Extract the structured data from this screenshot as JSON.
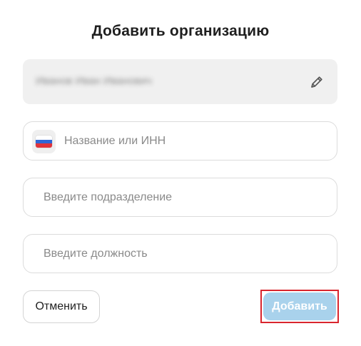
{
  "dialog": {
    "title": "Добавить организацию"
  },
  "user_field": {
    "value": "Иванов Иван Иванович",
    "edit_icon": "pencil-icon"
  },
  "organization": {
    "placeholder": "Название или ИНН",
    "country_flag": "russia-flag-icon"
  },
  "department": {
    "placeholder": "Введите подразделение"
  },
  "position": {
    "placeholder": "Введите должность"
  },
  "actions": {
    "cancel_label": "Отменить",
    "add_label": "Добавить"
  },
  "colors": {
    "add_button_bg": "#a9d2ec",
    "highlight_border": "#d9262e",
    "readonly_bg": "#f0f0f0"
  }
}
